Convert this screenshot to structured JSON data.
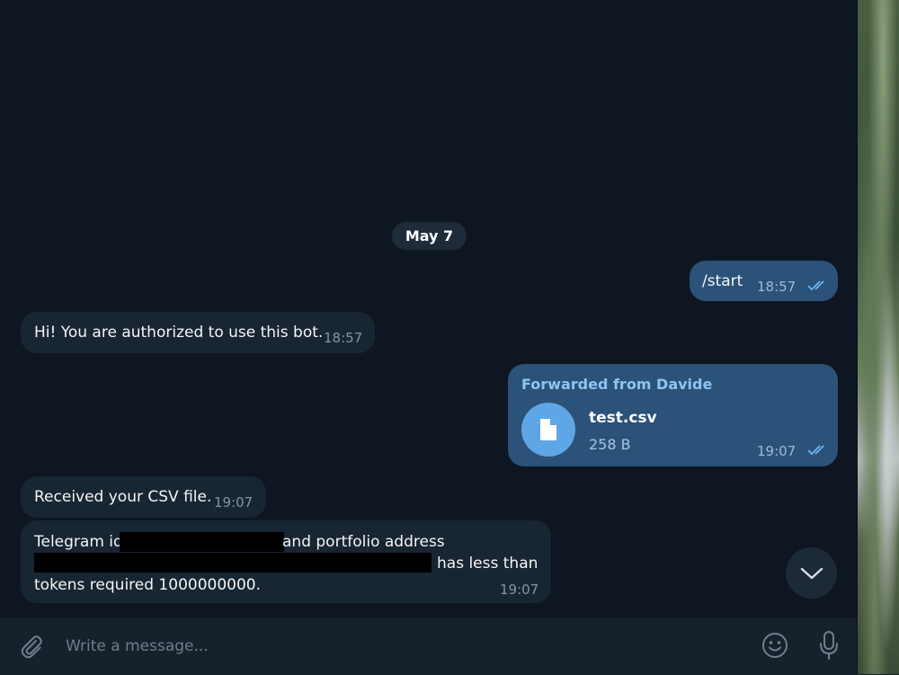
{
  "date_separator": "May 7",
  "messages": {
    "start_cmd": {
      "text": "/start",
      "time": "18:57"
    },
    "authorized": {
      "text": "Hi! You are authorized to use this bot.",
      "time": "18:57"
    },
    "forward": {
      "header": "Forwarded from Davide",
      "file_name": "test.csv",
      "file_size": "258 B",
      "time": "19:07"
    },
    "received": {
      "text": "Received your CSV file.",
      "time": "19:07"
    },
    "result": {
      "line1_prefix": "Telegram id",
      "line1_suffix": "and portfolio address",
      "line2_suffix": "has less than",
      "line3": "tokens required 1000000000.",
      "time": "19:07"
    }
  },
  "composer": {
    "placeholder": "Write a message..."
  },
  "icons": {
    "attach": "paperclip-icon",
    "emoji": "smiley-icon",
    "mic": "microphone-icon",
    "scroll": "chevron-down-icon",
    "read": "double-check-icon",
    "file": "document-icon"
  },
  "colors": {
    "chat_bg": "#0e1621",
    "incoming": "#182533",
    "outgoing": "#2b5278",
    "accent": "#5fa6e6"
  }
}
